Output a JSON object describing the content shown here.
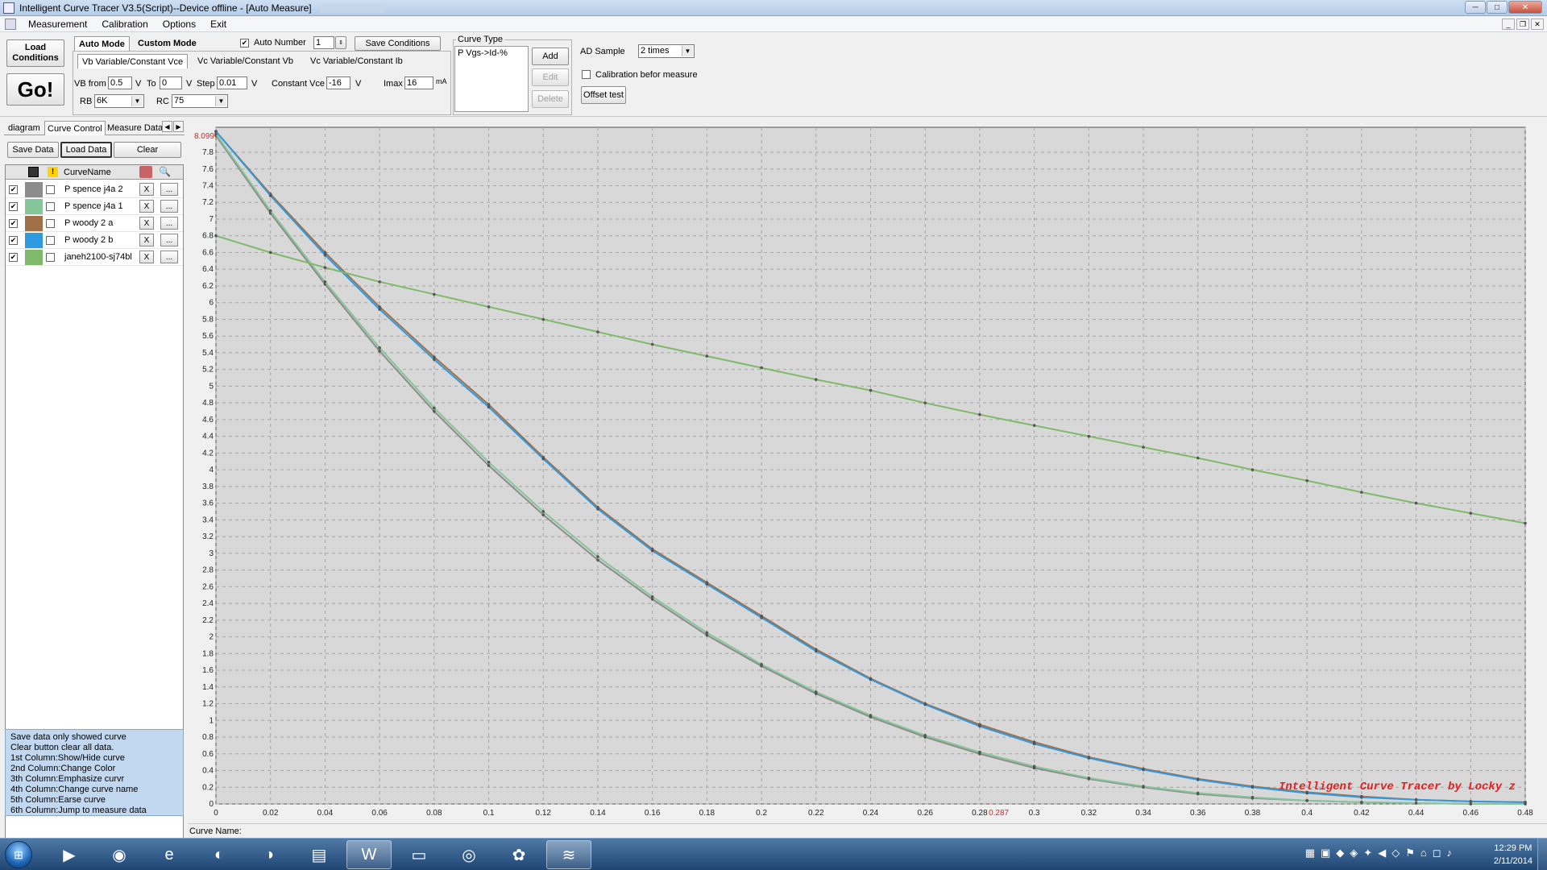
{
  "window": {
    "title": "Intelligent Curve Tracer V3.5(Script)--Device offline - [Auto Measure]",
    "min_glyph": "─",
    "max_glyph": "□",
    "close_glyph": "✕"
  },
  "menu": {
    "items": [
      "Measurement",
      "Calibration",
      "Options",
      "Exit"
    ]
  },
  "mdi": {
    "min_glyph": "_",
    "restore_glyph": "❐",
    "close_glyph": "✕"
  },
  "toolbar": {
    "load_conditions": "Load\nConditions",
    "go": "Go!",
    "mode_tabs": [
      "Auto Mode",
      "Custom Mode"
    ],
    "auto_number_label": "Auto Number",
    "auto_number_value": "1",
    "save_conditions": "Save Conditions",
    "sub_tabs": [
      "Vb Variable/Constant Vce",
      "Vc Variable/Constant Vb",
      "Vc Variable/Constant Ib"
    ],
    "vb_from_label": "VB from",
    "vb_from_value": "0.5",
    "v_unit": "V",
    "to_label": "To",
    "to_value": "0",
    "step_label": "Step",
    "step_value": "0.01",
    "constant_vce_label": "Constant Vce",
    "constant_vce_value": "-16",
    "imax_label": "Imax",
    "imax_value": "16",
    "ma_unit": "mA",
    "rb_label": "RB",
    "rb_value": "6K",
    "rc_label": "RC",
    "rc_value": "75",
    "curve_type_label": "Curve Type",
    "curve_type_item": "P Vgs->Id-%",
    "add": "Add",
    "edit": "Edit",
    "delete": "Delete",
    "ad_sample_label": "AD Sample",
    "ad_sample_value": "2 times",
    "calibration_label": "Calibration befor measure",
    "offset_test": "Offset test"
  },
  "left": {
    "tabs": [
      "diagram",
      "Curve Control",
      "Measure Data"
    ],
    "scroll_left": "◀",
    "scroll_right": "▶",
    "save_data": "Save Data",
    "load_data": "Load Data",
    "clear": "Clear",
    "grid_header": "CurveName",
    "warn_glyph": "!",
    "x_label": "X",
    "dots_label": "...",
    "check_glyph": "✔",
    "curves": [
      {
        "name": "P spence j4a 2",
        "color": "#8c8c8c"
      },
      {
        "name": "P spence j4a 1",
        "color": "#86c49a"
      },
      {
        "name": "P woody 2 a",
        "color": "#a07048"
      },
      {
        "name": "P woody 2 b",
        "color": "#2f9ae0"
      },
      {
        "name": "janeh2100-sj74bl",
        "color": "#7fba6a"
      }
    ],
    "help": [
      "Save data only showed curve",
      "Clear button clear all data.",
      "1st Column:Show/Hide curve",
      "2nd Column:Change Color",
      "3th Column:Emphasize curvr",
      "4th Column:Change curve name",
      "5th Column:Earse curve",
      "6th Column:Jump to measure data"
    ]
  },
  "chart_data": {
    "type": "line",
    "xlim": [
      0,
      0.48
    ],
    "ylim": [
      0,
      8.099
    ],
    "x_ticks": [
      0,
      0.02,
      0.04,
      0.06,
      0.08,
      0.1,
      0.12,
      0.14,
      0.16,
      0.18,
      0.2,
      0.22,
      0.24,
      0.26,
      0.28,
      0.3,
      0.32,
      0.34,
      0.36,
      0.38,
      0.4,
      0.42,
      0.44,
      0.46,
      0.48
    ],
    "y_ticks": [
      0,
      0.2,
      0.4,
      0.6,
      0.8,
      1,
      1.2,
      1.4,
      1.6,
      1.8,
      2,
      2.2,
      2.4,
      2.6,
      2.8,
      3,
      3.2,
      3.4,
      3.6,
      3.8,
      4,
      4.2,
      4.4,
      4.6,
      4.8,
      5,
      5.2,
      5.4,
      5.6,
      5.8,
      6,
      6.2,
      6.4,
      6.6,
      6.8,
      7,
      7.2,
      7.4,
      7.6,
      7.8
    ],
    "y_max_label": "8.099",
    "x_marker_label": "0.287",
    "x_marker": 0.287,
    "watermark": "Intelligent Curve Tracer by Locky z",
    "grid": true,
    "series": [
      {
        "color": "#8c8c8c",
        "x": [
          0,
          0.02,
          0.04,
          0.06,
          0.08,
          0.1,
          0.12,
          0.14,
          0.16,
          0.18,
          0.2,
          0.22,
          0.24,
          0.26,
          0.28,
          0.3,
          0.32,
          0.34,
          0.36,
          0.38,
          0.4,
          0.42,
          0.44,
          0.46,
          0.48
        ],
        "y": [
          8.0,
          7.07,
          6.22,
          5.42,
          4.7,
          4.05,
          3.46,
          2.92,
          2.45,
          2.02,
          1.65,
          1.32,
          1.04,
          0.8,
          0.6,
          0.43,
          0.3,
          0.2,
          0.12,
          0.07,
          0.04,
          0.02,
          0.01,
          0.0,
          0.0
        ]
      },
      {
        "color": "#86c49a",
        "x": [
          0,
          0.02,
          0.04,
          0.06,
          0.08,
          0.1,
          0.12,
          0.14,
          0.16,
          0.18,
          0.2,
          0.22,
          0.24,
          0.26,
          0.28,
          0.3,
          0.32,
          0.34,
          0.36,
          0.38,
          0.4,
          0.42,
          0.44,
          0.46,
          0.48
        ],
        "y": [
          8.02,
          7.1,
          6.25,
          5.46,
          4.74,
          4.09,
          3.5,
          2.96,
          2.48,
          2.05,
          1.67,
          1.34,
          1.06,
          0.82,
          0.62,
          0.45,
          0.31,
          0.21,
          0.13,
          0.08,
          0.04,
          0.02,
          0.01,
          0.0,
          0.0
        ]
      },
      {
        "color": "#a07048",
        "x": [
          0,
          0.02,
          0.04,
          0.06,
          0.08,
          0.1,
          0.12,
          0.14,
          0.16,
          0.18,
          0.2,
          0.22,
          0.24,
          0.26,
          0.28,
          0.3,
          0.32,
          0.34,
          0.36,
          0.38,
          0.4,
          0.42,
          0.44,
          0.46,
          0.48
        ],
        "y": [
          8.05,
          7.3,
          6.6,
          5.95,
          5.35,
          4.78,
          4.15,
          3.55,
          3.05,
          2.65,
          2.25,
          1.85,
          1.5,
          1.2,
          0.95,
          0.74,
          0.56,
          0.42,
          0.3,
          0.21,
          0.14,
          0.09,
          0.05,
          0.03,
          0.02
        ]
      },
      {
        "color": "#2f9ae0",
        "x": [
          0,
          0.02,
          0.04,
          0.06,
          0.08,
          0.1,
          0.12,
          0.14,
          0.16,
          0.18,
          0.2,
          0.22,
          0.24,
          0.26,
          0.28,
          0.3,
          0.32,
          0.34,
          0.36,
          0.38,
          0.4,
          0.42,
          0.44,
          0.46,
          0.48
        ],
        "y": [
          8.05,
          7.28,
          6.57,
          5.92,
          5.32,
          4.75,
          4.13,
          3.53,
          3.03,
          2.63,
          2.23,
          1.83,
          1.49,
          1.19,
          0.93,
          0.72,
          0.55,
          0.41,
          0.29,
          0.2,
          0.13,
          0.08,
          0.05,
          0.03,
          0.02
        ]
      },
      {
        "color": "#7fba6a",
        "x": [
          0,
          0.02,
          0.04,
          0.06,
          0.08,
          0.1,
          0.12,
          0.14,
          0.16,
          0.18,
          0.2,
          0.22,
          0.24,
          0.26,
          0.28,
          0.3,
          0.32,
          0.34,
          0.36,
          0.38,
          0.4,
          0.42,
          0.44,
          0.46,
          0.48
        ],
        "y": [
          6.8,
          6.6,
          6.42,
          6.25,
          6.1,
          5.95,
          5.8,
          5.65,
          5.5,
          5.36,
          5.22,
          5.08,
          4.95,
          4.8,
          4.66,
          4.53,
          4.4,
          4.27,
          4.14,
          4.0,
          3.87,
          3.73,
          3.6,
          3.48,
          3.36
        ]
      }
    ]
  },
  "status": {
    "curve_name_label": "Curve Name:"
  },
  "taskbar": {
    "start_glyph": "⊞",
    "apps": [
      "▶",
      "◉",
      "e",
      "◐",
      "◑",
      "▤",
      "W",
      "▭",
      "◎",
      "✿",
      "≋"
    ],
    "tray_icons": [
      "▦",
      "▣",
      "◆",
      "◈",
      "✦",
      "◀",
      "◇",
      "⚑",
      "⌂",
      "◻",
      "♪"
    ],
    "time": "12:29 PM",
    "date": "2/11/2014"
  }
}
